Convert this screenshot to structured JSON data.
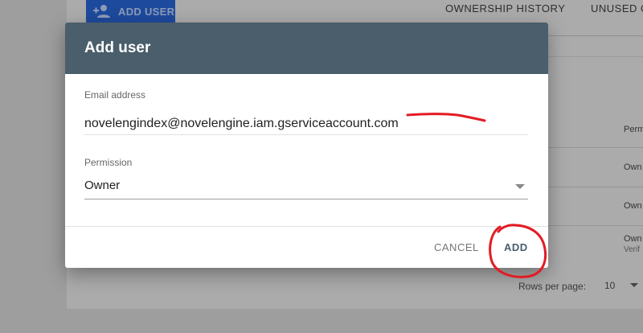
{
  "background": {
    "add_user_label": "ADD USER",
    "tabs": [
      "OWNERSHIP HISTORY",
      "UNUSED O"
    ],
    "table_cells": [
      "Perm",
      "Own",
      "Own",
      "Own"
    ],
    "table_subtext": "Verif",
    "rows_per_page_label": "Rows per page:",
    "rows_per_page_value": "10"
  },
  "dialog": {
    "title": "Add user",
    "email_label": "Email address",
    "email_value": "novelengindex@novelengine.iam.gserviceaccount.com",
    "permission_label": "Permission",
    "permission_value": "Owner",
    "cancel_label": "CANCEL",
    "add_label": "ADD"
  },
  "colors": {
    "header": "#4a5e6b",
    "annotation": "#e31b23",
    "overlay": "#9e9e9e"
  },
  "icons": [
    "person-add-icon",
    "chevron-down-icon"
  ]
}
